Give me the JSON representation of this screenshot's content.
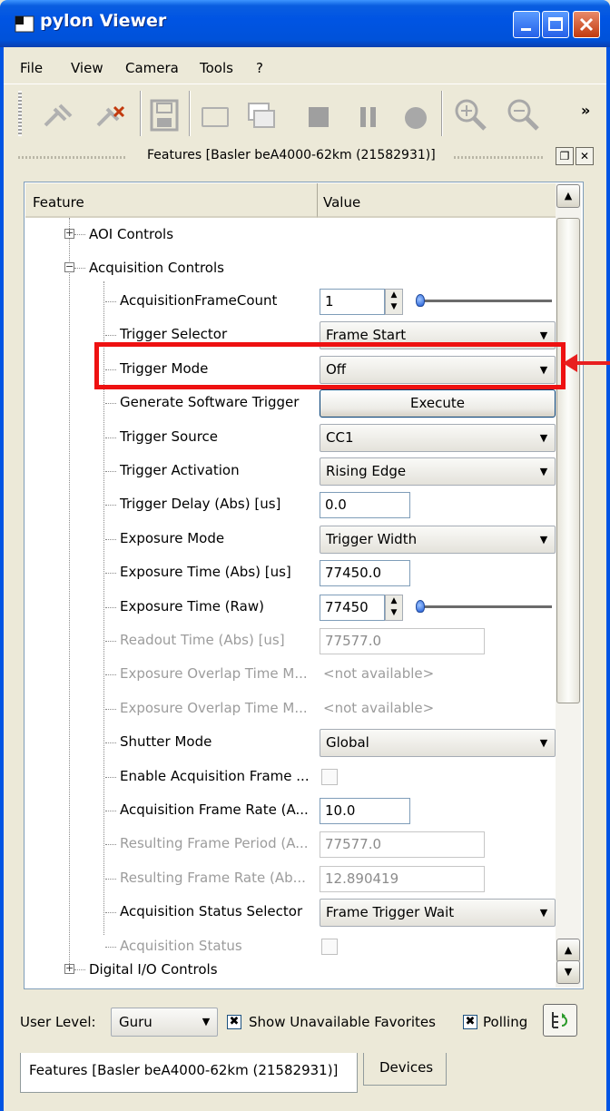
{
  "window": {
    "title": "pylon Viewer"
  },
  "menu": [
    "File",
    "View",
    "Camera",
    "Tools",
    "?"
  ],
  "toolbar": {
    "icons": [
      "disconnect-icon",
      "connect-icon",
      "save-icon",
      "single-frame-icon",
      "multi-frame-icon",
      "stop-icon",
      "pause-icon",
      "record-icon",
      "zoom-in-icon",
      "zoom-out-icon"
    ],
    "overflow": "»"
  },
  "dock": {
    "title": "Features [Basler beA4000-62km (21582931)]"
  },
  "columns": {
    "feature": "Feature",
    "value": "Value"
  },
  "tree": {
    "aoi": "AOI Controls",
    "acq": "Acquisition Controls",
    "digital": "Digital I/O Controls"
  },
  "rows": [
    {
      "label": "AcquisitionFrameCount",
      "value": "1",
      "kind": "spin-slider"
    },
    {
      "label": "Trigger Selector",
      "value": "Frame Start",
      "kind": "combo"
    },
    {
      "label": "Trigger Mode",
      "value": "Off",
      "kind": "combo"
    },
    {
      "label": "Generate Software Trigger",
      "value": "Execute",
      "kind": "button"
    },
    {
      "label": "Trigger Source",
      "value": "CC1",
      "kind": "combo"
    },
    {
      "label": "Trigger Activation",
      "value": "Rising Edge",
      "kind": "combo"
    },
    {
      "label": "Trigger Delay (Abs) [us]",
      "value": "0.0",
      "kind": "text"
    },
    {
      "label": "Exposure Mode",
      "value": "Trigger Width",
      "kind": "combo"
    },
    {
      "label": "Exposure Time (Abs) [us]",
      "value": "77450.0",
      "kind": "text"
    },
    {
      "label": "Exposure Time (Raw)",
      "value": "77450",
      "kind": "spin-slider"
    },
    {
      "label": "Readout Time (Abs) [us]",
      "value": "77577.0",
      "kind": "text-dis"
    },
    {
      "label": "Exposure Overlap Time M...",
      "value": "<not available>",
      "kind": "na"
    },
    {
      "label": "Exposure Overlap Time M...",
      "value": "<not available>",
      "kind": "na"
    },
    {
      "label": "Shutter Mode",
      "value": "Global",
      "kind": "combo"
    },
    {
      "label": "Enable Acquisition Frame ...",
      "value": "",
      "kind": "check"
    },
    {
      "label": "Acquisition Frame Rate (A...",
      "value": "10.0",
      "kind": "text"
    },
    {
      "label": "Resulting Frame Period (A...",
      "value": "77577.0",
      "kind": "text-dis"
    },
    {
      "label": "Resulting Frame Rate (Ab...",
      "value": "12.890419",
      "kind": "text-dis"
    },
    {
      "label": "Acquisition Status Selector",
      "value": "Frame Trigger Wait",
      "kind": "combo"
    },
    {
      "label": "Acquisition Status",
      "value": "",
      "kind": "check-dis"
    }
  ],
  "bottom": {
    "user_level_label": "User Level:",
    "user_level_value": "Guru",
    "show_unavailable": "Show Unavailable Favorites",
    "polling": "Polling",
    "checked_glyph": "✖"
  },
  "tabs": {
    "features": "Features [Basler beA4000-62km (21582931)]",
    "devices": "Devices"
  },
  "colors": {
    "titlebar": "#0054e3",
    "highlight": "#ee1111",
    "face": "#ece9d8"
  }
}
